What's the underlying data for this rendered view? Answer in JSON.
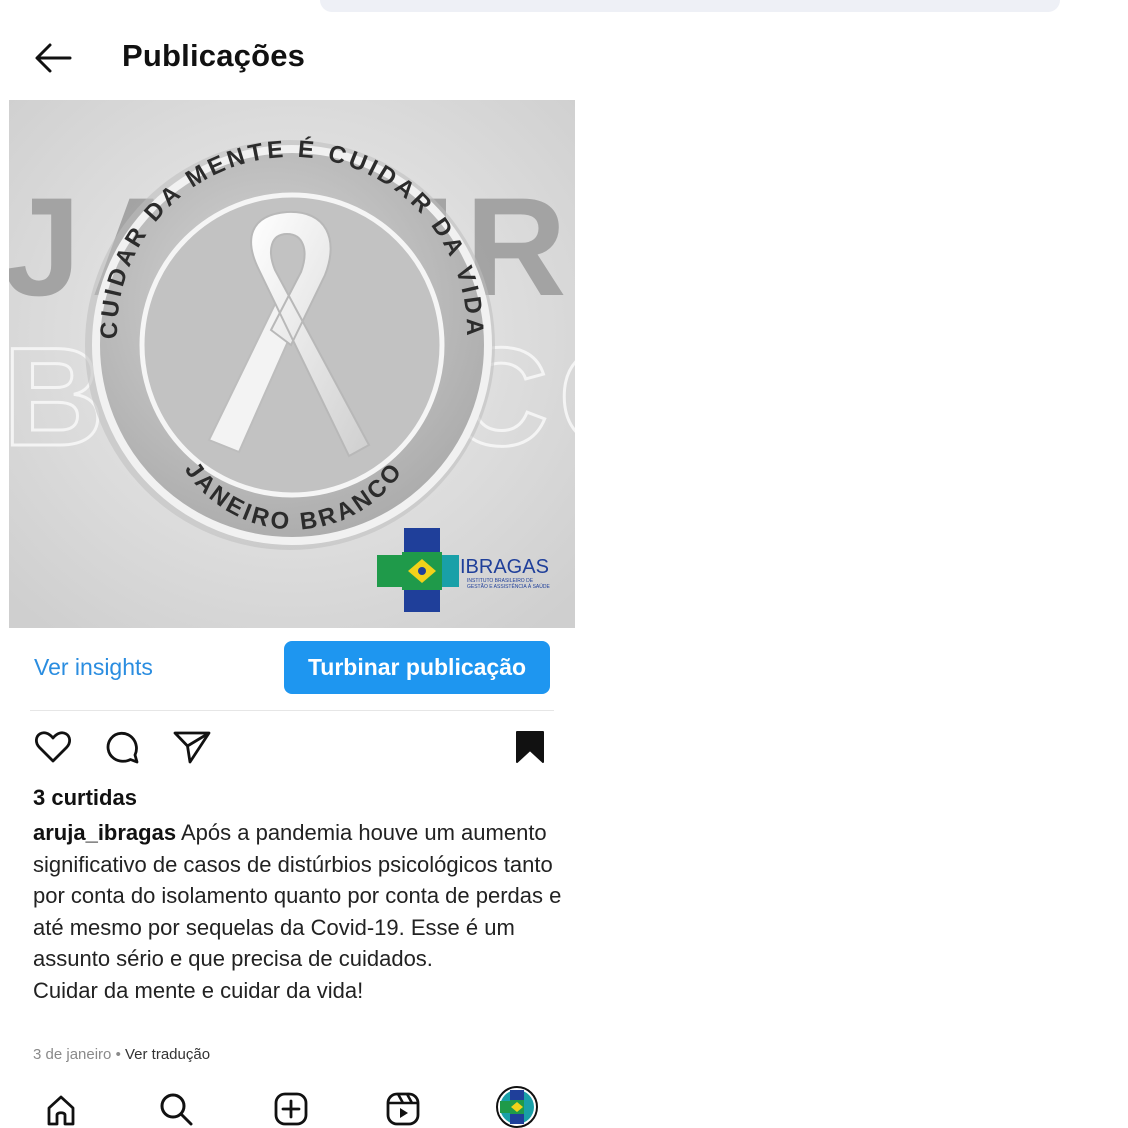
{
  "header": {
    "title": "Publicações",
    "back_icon": "arrow-left-icon"
  },
  "post_image": {
    "ring_text_top": "CUIDAR DA MENTE É CUIDAR DA VIDA",
    "ring_text_bottom": "JANEIRO BRANCO",
    "background_word_1": "JANEIRO",
    "background_word_2": "BRANCO",
    "logo_name": "IBRAGAS",
    "logo_tagline_1": "INSTITUTO BRASILEIRO DE",
    "logo_tagline_2": "GESTÃO E ASSISTÊNCIA À SAÚDE"
  },
  "actions": {
    "insights_label": "Ver insights",
    "boost_label": "Turbinar publicação",
    "like_icon": "heart-icon",
    "comment_icon": "comment-icon",
    "share_icon": "send-icon",
    "save_icon": "bookmark-icon"
  },
  "post": {
    "likes": "3 curtidas",
    "username": "aruja_ibragas",
    "caption": "Após a pandemia houve um aumento significativo de casos de distúrbios psicológicos tanto por conta do isolamento quanto por conta de perdas e até mesmo por sequelas da Covid-19. Esse é um assunto sério e que precisa de cuidados.",
    "caption_line2": "Cuidar da mente e cuidar da vida!",
    "date": "3 de janeiro",
    "separator": " • ",
    "translate_label": "Ver tradução"
  },
  "bottom_nav": {
    "items": [
      "home-icon",
      "search-icon",
      "create-icon",
      "reels-icon",
      "profile-avatar"
    ]
  },
  "colors": {
    "accent": "#1e96f0",
    "link": "#2a8de0",
    "logo_blue": "#1f3f9a",
    "logo_green": "#1f9a4a",
    "logo_teal": "#19a0a8",
    "logo_yellow": "#f2d21a"
  }
}
